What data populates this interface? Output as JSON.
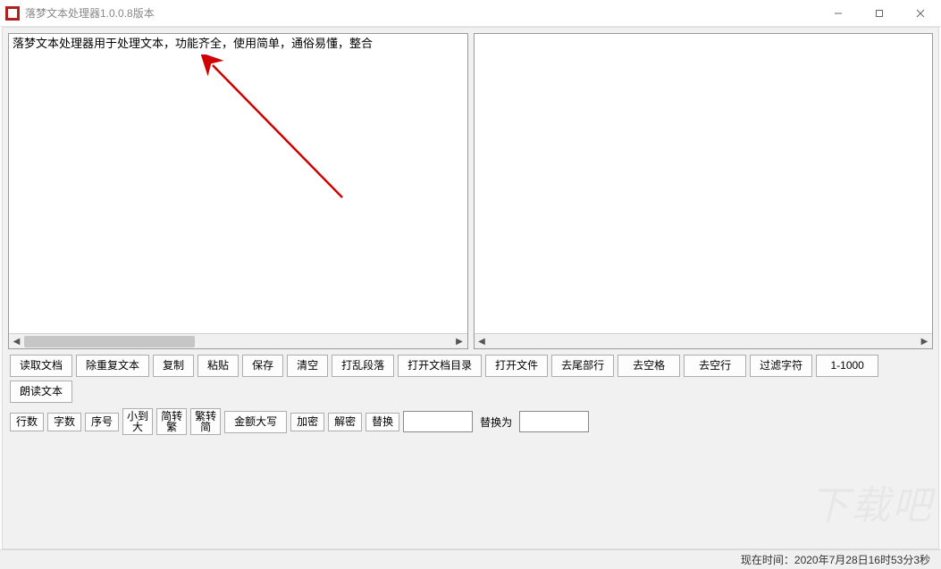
{
  "window": {
    "title": "落梦文本处理器1.0.0.8版本"
  },
  "left_pane": {
    "text": "落梦文本处理器用于处理文本，功能齐全，使用简单，通俗易懂，整合",
    "scroll_thumb_width_pct": 40
  },
  "right_pane": {
    "text": ""
  },
  "toolbar1": {
    "read_doc": "读取文档",
    "dedupe": "除重复文本",
    "copy": "复制",
    "paste": "粘贴",
    "save": "保存",
    "clear": "清空",
    "shuffle_para": "打乱段落",
    "open_dir": "打开文档目录",
    "open_file": "打开文件",
    "trim_tail": "去尾部行",
    "trim_space": "去空格",
    "trim_empty_line": "去空行",
    "filter_chars": "过滤字符",
    "range": "1-1000",
    "read_aloud": "朗读文本"
  },
  "toolbar2": {
    "lines": "行数",
    "chars": "字数",
    "index": "序号",
    "sort_asc_l1": "小到",
    "sort_asc_l2": "大",
    "s2t_l1": "简转",
    "s2t_l2": "繁",
    "t2s_l1": "繁转",
    "t2s_l2": "简",
    "money_upper": "金额大写",
    "encrypt": "加密",
    "decrypt": "解密",
    "replace": "替换",
    "find_value": "",
    "replace_label": "替换为",
    "replace_value": ""
  },
  "status": {
    "now_label": "现在时间：",
    "now_value": "2020年7月28日16时53分3秒"
  },
  "watermark": "下载吧"
}
